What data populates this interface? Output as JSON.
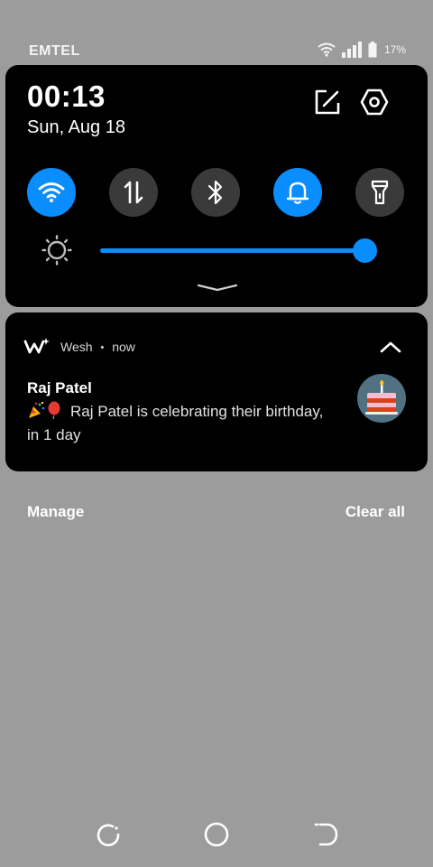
{
  "status_bar": {
    "carrier": "EMTEL",
    "battery_pct": "17%",
    "icons": [
      "wifi-icon",
      "signal-icon",
      "battery-icon"
    ]
  },
  "quick_settings": {
    "time": "00:13",
    "date": "Sun, Aug 18",
    "actions": [
      "edit-icon",
      "settings-icon"
    ],
    "tiles": [
      {
        "name": "wifi",
        "icon": "wifi-icon",
        "active": true
      },
      {
        "name": "mobile-data",
        "icon": "data-transfer-icon",
        "active": false
      },
      {
        "name": "bluetooth",
        "icon": "bluetooth-icon",
        "active": false
      },
      {
        "name": "notifications",
        "icon": "bell-icon",
        "active": true
      },
      {
        "name": "flashlight",
        "icon": "flashlight-icon",
        "active": false
      }
    ],
    "brightness_level": 1.0,
    "accent_color": "#0a8dff",
    "tile_off_color": "#3a3a3a"
  },
  "notification": {
    "app_name": "Wesh",
    "separator": "•",
    "time": "now",
    "title": "Raj Patel",
    "body_emojis": [
      "party-popper-icon",
      "balloon-icon"
    ],
    "body": "Raj Patel is celebrating their birthday, in 1 day",
    "avatar": "birthday-cake-icon"
  },
  "actions": {
    "manage": "Manage",
    "clear_all": "Clear all"
  },
  "nav_bar": [
    "recent-apps-icon",
    "home-icon",
    "back-icon"
  ]
}
